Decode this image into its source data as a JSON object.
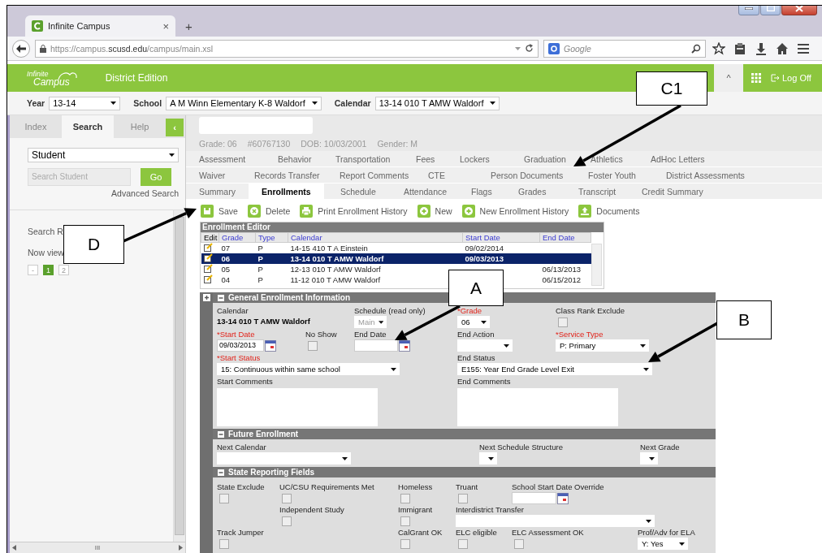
{
  "browser": {
    "tab_title": "Infinite Campus",
    "tab_close": "×",
    "new_tab": "+",
    "url": "https://campus.**scusd.edu**/campus/main.xsl",
    "search_placeholder": "Google"
  },
  "header": {
    "logo_top": "Infinite",
    "logo_bottom": "Campus",
    "edition": "District Edition",
    "collapse": "^",
    "logoff": "Log Off"
  },
  "context": [
    {
      "label": "Year",
      "value": "13-14"
    },
    {
      "label": "School",
      "value": "A M Winn Elementary K-8 Waldorf"
    },
    {
      "label": "Calendar",
      "value": "13-14 010 T AMW Waldorf"
    }
  ],
  "sidebar": {
    "tabs": [
      {
        "label": "Index",
        "selected": false
      },
      {
        "label": "Search",
        "selected": true
      },
      {
        "label": "Help",
        "selected": false
      }
    ],
    "collapse": "‹",
    "search_type": "Student",
    "search_placeholder": "Search Student",
    "go": "Go",
    "advanced": "Advanced Search",
    "results_heading": "Search R",
    "now_viewing": "Now view",
    "pages": [
      {
        "label": "-",
        "selected": false
      },
      {
        "label": "1",
        "selected": true
      },
      {
        "label": "2",
        "selected": false
      }
    ],
    "scroll_grip": "III"
  },
  "student": {
    "details": [
      "Grade: 06",
      "#60767130",
      "DOB: 10/03/2001",
      "Gender: M"
    ]
  },
  "tab_rows": [
    [
      {
        "label": "Assessment",
        "selected": false
      },
      {
        "label": "Behavior",
        "selected": false
      },
      {
        "label": "Transportation",
        "selected": false
      },
      {
        "label": "Fees",
        "selected": false
      },
      {
        "label": "Lockers",
        "selected": false
      },
      {
        "label": "Graduation",
        "selected": false
      },
      {
        "label": "Athletics",
        "selected": false
      },
      {
        "label": "AdHoc Letters",
        "selected": false
      }
    ],
    [
      {
        "label": "Waiver",
        "selected": false
      },
      {
        "label": "Records Transfer",
        "selected": false
      },
      {
        "label": "Report Comments",
        "selected": false
      },
      {
        "label": "CTE",
        "selected": false
      },
      {
        "label": "Person Documents",
        "selected": false
      },
      {
        "label": "Foster Youth",
        "selected": false
      },
      {
        "label": "District Assessments",
        "selected": false
      }
    ],
    [
      {
        "label": "Summary",
        "selected": false
      },
      {
        "label": "Enrollments",
        "selected": true
      },
      {
        "label": "Schedule",
        "selected": false
      },
      {
        "label": "Attendance",
        "selected": false
      },
      {
        "label": "Flags",
        "selected": false
      },
      {
        "label": "Grades",
        "selected": false
      },
      {
        "label": "Transcript",
        "selected": false
      },
      {
        "label": "Credit Summary",
        "selected": false
      }
    ]
  ],
  "toolbar": [
    {
      "label": "Save",
      "kind": "save"
    },
    {
      "label": "Delete",
      "kind": "delete"
    },
    {
      "label": "Print Enrollment History",
      "kind": "print"
    },
    {
      "label": "New",
      "kind": "new"
    },
    {
      "label": "New Enrollment History",
      "kind": "new"
    },
    {
      "label": "Documents",
      "kind": "upload"
    }
  ],
  "enrollment_editor": {
    "title": "Enrollment Editor",
    "columns": [
      "Edit",
      "Grade",
      "Type",
      "Calendar",
      "Start Date",
      "End Date"
    ],
    "rows": [
      {
        "grade": "07",
        "type": "P",
        "calendar": "14-15 410 T A Einstein",
        "start_date": "09/02/2014",
        "selected": false
      },
      {
        "grade": "06",
        "type": "P",
        "calendar": "13-14 010 T AMW Waldorf",
        "start_date": "09/03/2013",
        "selected": true
      },
      {
        "grade": "05",
        "type": "P",
        "calendar": "12-13 010 T AMW Waldorf",
        "end_date": "06/13/2013",
        "selected": false
      },
      {
        "grade": "04",
        "type": "P",
        "calendar": "11-12 010 T AMW Waldorf",
        "end_date": "06/15/2012",
        "selected": false
      }
    ]
  },
  "general": {
    "title": "General Enrollment Information",
    "fields": [
      {
        "kind": "static",
        "label": "Calendar",
        "value": "13-14 010 T AMW Waldorf",
        "required": false
      },
      {
        "kind": "select",
        "label": "Schedule (read only)",
        "value": "Main",
        "required": false,
        "disabled": true
      },
      {
        "kind": "select",
        "label": "*Grade",
        "value": "06",
        "required": true
      },
      {
        "kind": "checkbox",
        "label": "Class Rank Exclude",
        "checked": false,
        "required": false
      },
      {
        "kind": "date",
        "label": "*Start Date",
        "value": "09/03/2013",
        "required": true
      },
      {
        "kind": "checkbox",
        "label": "No Show",
        "checked": false,
        "required": false
      },
      {
        "kind": "date",
        "label": "End Date",
        "required": false
      },
      {
        "kind": "select",
        "label": "End Action",
        "required": false
      },
      {
        "kind": "select",
        "label": "*Service Type",
        "value": "P: Primary",
        "required": true
      },
      {
        "kind": "select",
        "label": "*Start Status",
        "value": "15: Continuous within same school",
        "required": true
      },
      {
        "kind": "select",
        "label": "End Status",
        "value": "E155: Year End Grade Level Exit",
        "required": false
      },
      {
        "kind": "textarea",
        "label": "Start Comments",
        "required": false
      },
      {
        "kind": "textarea",
        "label": "End Comments",
        "required": false
      }
    ]
  },
  "future": {
    "title": "Future Enrollment",
    "fields": [
      {
        "kind": "select",
        "label": "Next Calendar"
      },
      {
        "kind": "select",
        "label": "Next Schedule Structure"
      },
      {
        "kind": "select",
        "label": "Next Grade"
      }
    ]
  },
  "state_reporting": {
    "title": "State Reporting Fields",
    "fields": [
      {
        "kind": "checkbox",
        "label": "State Exclude",
        "checked": false
      },
      {
        "kind": "checkbox",
        "label": "UC/CSU Requirements Met",
        "checked": false
      },
      {
        "kind": "checkbox",
        "label": "Homeless",
        "checked": false
      },
      {
        "kind": "checkbox",
        "label": "Truant",
        "checked": false
      },
      {
        "kind": "date",
        "label": "School Start Date Override"
      },
      {
        "kind": "checkbox",
        "label": "Independent Study",
        "checked": false
      },
      {
        "kind": "checkbox",
        "label": "Immigrant",
        "checked": false
      },
      {
        "kind": "select",
        "label": "Interdistrict Transfer"
      },
      {
        "kind": "checkbox",
        "label": "Track Jumper",
        "checked": false
      },
      {
        "kind": "checkbox",
        "label": "CalGrant OK",
        "checked": false
      },
      {
        "kind": "checkbox",
        "label": "ELC eligible",
        "checked": false
      },
      {
        "kind": "checkbox",
        "label": "ELC Assessment OK",
        "checked": false
      },
      {
        "kind": "select",
        "label": "Prof/Adv for ELA",
        "value": "Y: Yes"
      }
    ]
  },
  "callouts": [
    {
      "label": "C1"
    },
    {
      "label": "D"
    },
    {
      "label": "A"
    },
    {
      "label": "B"
    }
  ]
}
